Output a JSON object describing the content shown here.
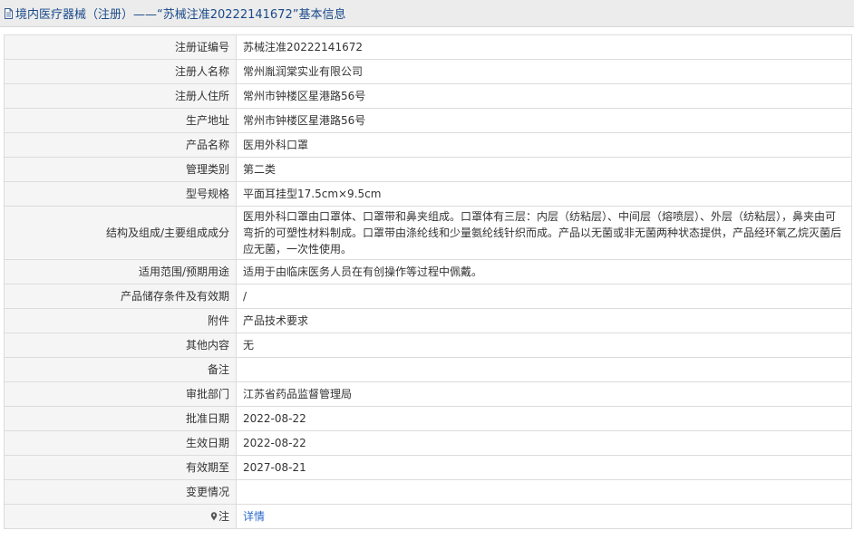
{
  "header": {
    "title": "境内医疗器械（注册）——“苏械注准20222141672”基本信息",
    "icon": "document-icon"
  },
  "rows": [
    {
      "label": "注册证编号",
      "value": "苏械注准20222141672"
    },
    {
      "label": "注册人名称",
      "value": "常州胤润棠实业有限公司"
    },
    {
      "label": "注册人住所",
      "value": "常州市钟楼区星港路56号"
    },
    {
      "label": "生产地址",
      "value": "常州市钟楼区星港路56号"
    },
    {
      "label": "产品名称",
      "value": "医用外科口罩"
    },
    {
      "label": "管理类别",
      "value": "第二类"
    },
    {
      "label": "型号规格",
      "value": "平面耳挂型17.5cm×9.5cm"
    },
    {
      "label": "结构及组成/主要组成成分",
      "value": "医用外科口罩由口罩体、口罩带和鼻夹组成。口罩体有三层：内层（纺粘层）、中间层（熔喷层）、外层（纺粘层），鼻夹由可弯折的可塑性材料制成。口罩带由涤纶线和少量氨纶线针织而成。产品以无菌或非无菌两种状态提供，产品经环氧乙烷灭菌后应无菌，一次性使用。"
    },
    {
      "label": "适用范围/预期用途",
      "value": "适用于由临床医务人员在有创操作等过程中佩戴。"
    },
    {
      "label": "产品储存条件及有效期",
      "value": "/"
    },
    {
      "label": "附件",
      "value": "产品技术要求"
    },
    {
      "label": "其他内容",
      "value": "无"
    },
    {
      "label": "备注",
      "value": ""
    },
    {
      "label": "审批部门",
      "value": "江苏省药品监督管理局"
    },
    {
      "label": "批准日期",
      "value": "2022-08-22"
    },
    {
      "label": "生效日期",
      "value": "2022-08-22"
    },
    {
      "label": "有效期至",
      "value": "2027-08-21"
    },
    {
      "label": "变更情况",
      "value": ""
    }
  ],
  "note": {
    "icon": "map-pin-icon",
    "label": "注",
    "link": "详情"
  },
  "colors": {
    "header_bg": "#ececec",
    "title": "#1a4a8a",
    "label_bg": "#f5f5f5",
    "border": "#dcdcdc",
    "link": "#2a6acb"
  }
}
